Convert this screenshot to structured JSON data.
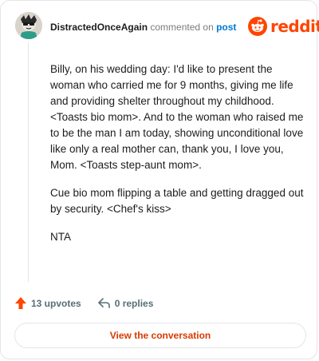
{
  "comment": {
    "username": "DistractedOnceAgain",
    "action_text": " commented on ",
    "post_link_text": "post",
    "paragraphs": [
      "Billy, on his wedding day: I'd like to present the woman who carried me for 9 months, giving me life and providing shelter throughout my childhood. <Toasts bio mom>. And to the woman who raised me to be the man I am today, showing unconditional love like only a real mother can, thank you, I love you, Mom. <Toasts step-aunt mom>.",
      "Cue bio mom flipping a table and getting dragged out by security. <Chef's kiss>",
      "NTA"
    ]
  },
  "brand": {
    "wordmark": "reddit",
    "color": "#ff4500"
  },
  "actions": {
    "upvotes_label": "13 upvotes",
    "replies_label": "0 replies"
  },
  "cta": {
    "label": "View the conversation"
  },
  "colors": {
    "upvote_arrow": "#ff4500",
    "link": "#0079d3",
    "cta_text": "#d93a00",
    "muted": "#576f76"
  },
  "icons": {
    "avatar": "avatar",
    "logo": "reddit-snoo-icon",
    "upvote": "upvote-arrow-icon",
    "reply": "reply-arrow-icon"
  }
}
